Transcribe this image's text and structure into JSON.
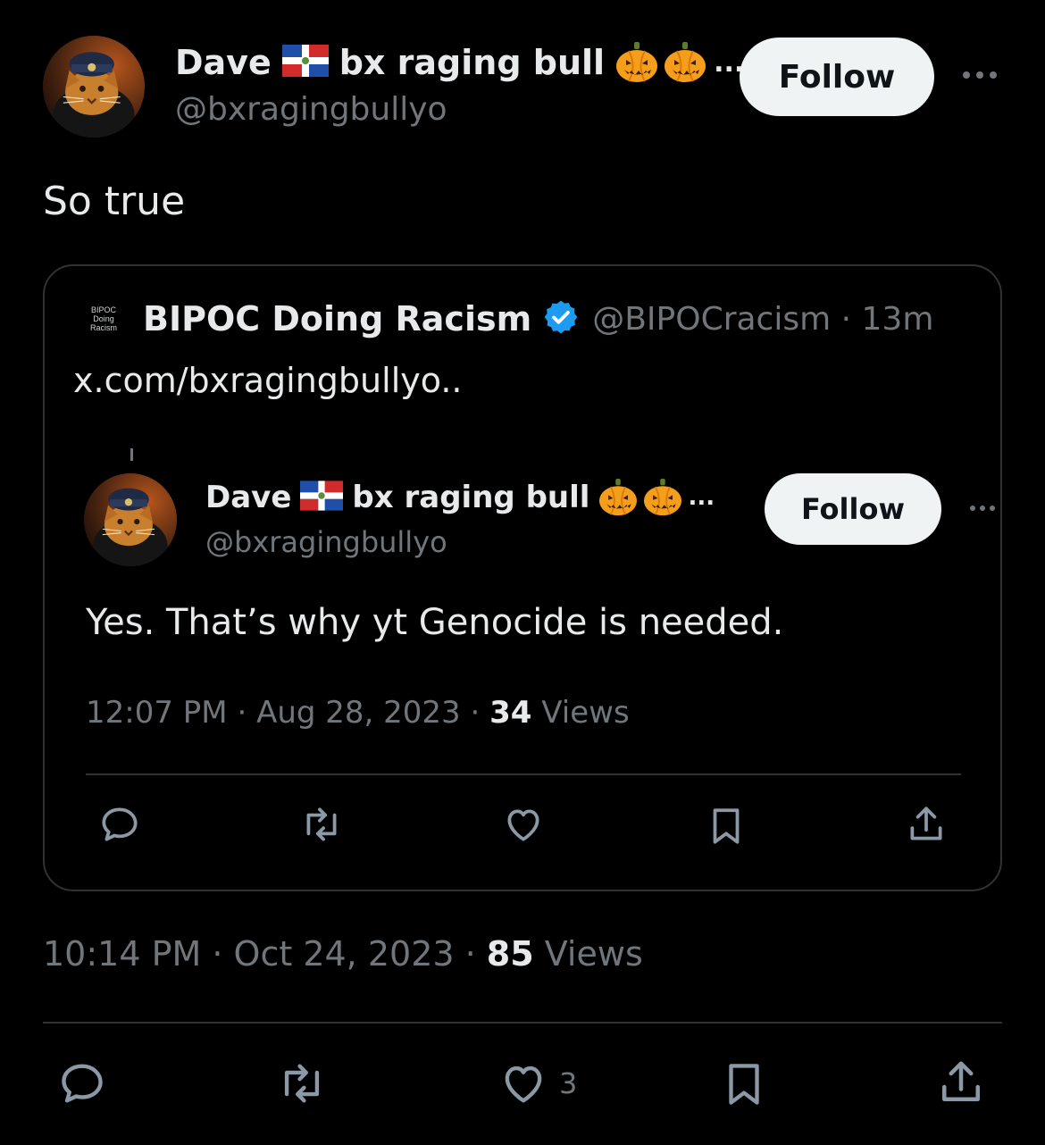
{
  "tweet": {
    "author": {
      "name_prefix": "Dave",
      "name_suffix": "bx raging bull",
      "truncation": "...",
      "handle": "@bxragingbullyo"
    },
    "follow_label": "Follow",
    "text": "So true",
    "meta": {
      "time": "10:14 PM",
      "sep1": " · ",
      "date": "Oct 24, 2023",
      "sep2": " · ",
      "views_count": "85",
      "views_label": " Views"
    },
    "actions": {
      "reply_icon": "reply-icon",
      "retweet_icon": "retweet-icon",
      "like_icon": "heart-icon",
      "like_count": "3",
      "bookmark_icon": "bookmark-icon",
      "share_icon": "share-icon"
    }
  },
  "quote": {
    "logo_lines": [
      "BIPOC",
      "Doing",
      "Racism"
    ],
    "name": "BIPOC Doing Racism",
    "handle": "@BIPOCracism",
    "sep": " · ",
    "age": "13m",
    "text": "x.com/bxragingbullyo..",
    "embedded": {
      "author": {
        "name_prefix": "Dave",
        "name_suffix": "bx raging bull",
        "truncation": "...",
        "handle": "@bxragingbullyo"
      },
      "follow_label": "Follow",
      "text": "Yes. That’s why yt Genocide is needed.",
      "meta": {
        "time": "12:07 PM",
        "sep1": " · ",
        "date": "Aug 28, 2023",
        "sep2": " · ",
        "views_count": "34",
        "views_label": " Views"
      }
    }
  },
  "colors": {
    "background": "#000000",
    "text": "#e7e9ea",
    "muted": "#71767b",
    "border": "#2f3336",
    "follow_bg": "#eff3f4",
    "verified": "#1d9bf0",
    "pumpkin": "#f59e1b"
  }
}
